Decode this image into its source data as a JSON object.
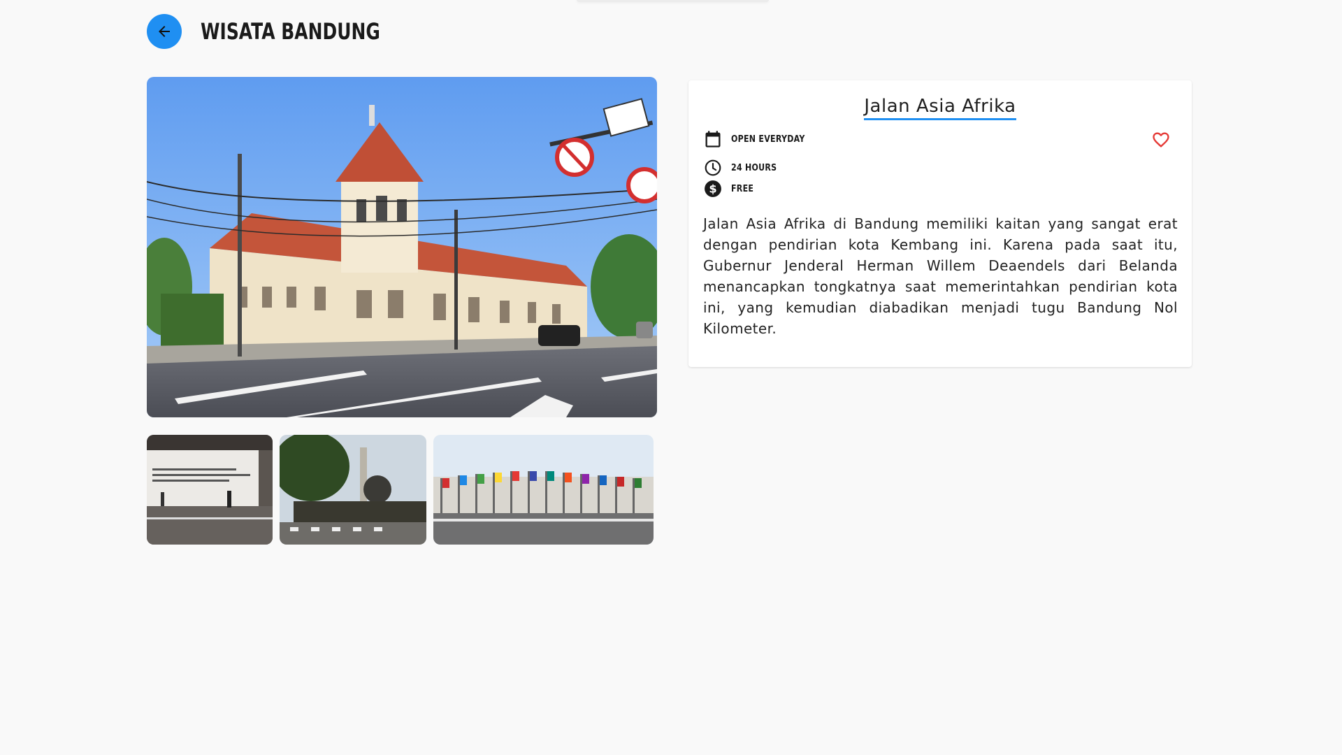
{
  "header": {
    "title": "WISATA BANDUNG",
    "back_icon": "arrow-left-icon"
  },
  "colors": {
    "accent": "#1f8ff2",
    "favorite": "#e53935",
    "background": "#f9f9f9"
  },
  "gallery": {
    "main_image": "jalan-asia-afrika-building-photo",
    "thumbnails": [
      "museum-wall-photo",
      "asia-afrika-monument-photo",
      "flags-street-photo"
    ]
  },
  "place": {
    "name": "Jalan Asia Afrika",
    "schedule": "OPEN EVERYDAY",
    "hours": "24 HOURS",
    "price": "FREE",
    "favorite_icon": "heart-outline-icon",
    "description": "Jalan Asia Afrika di Bandung memiliki kaitan yang sangat erat dengan pendirian kota Kembang ini. Karena pada saat itu, Gubernur Jenderal Herman Willem Deaendels dari Belanda menancapkan tongkatnya saat memerintahkan pendirian kota ini, yang kemudian diabadikan menjadi tugu Bandung Nol Kilometer."
  }
}
